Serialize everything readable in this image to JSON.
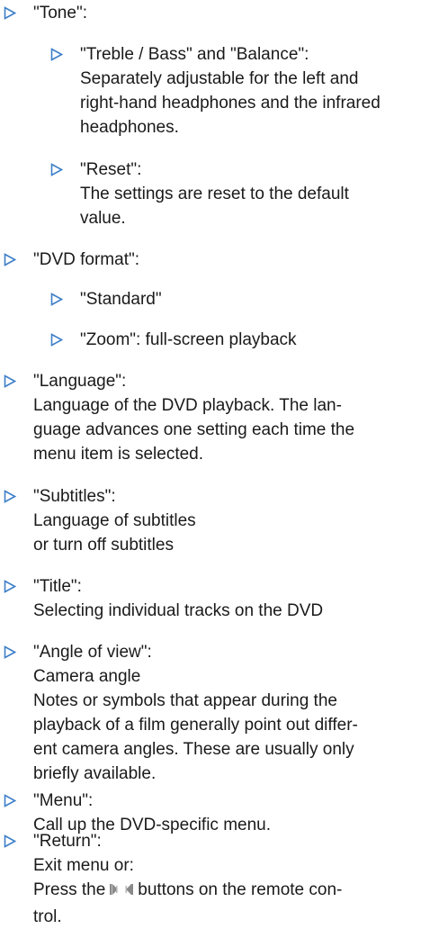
{
  "colors": {
    "arrow": "#3d7fc9",
    "text": "#1a1a1a"
  },
  "icons": {
    "bullet": "triangle-right-outline-icon",
    "buttons": "skip-buttons-icon"
  },
  "items": {
    "tone": {
      "title": "\"Tone\":"
    },
    "treble": {
      "title": "\"Treble / Bass\" and \"Balance\":",
      "desc": [
        "Separately adjustable for the left and",
        "right-hand headphones and the infrared",
        "headphones."
      ]
    },
    "reset": {
      "title": "\"Reset\":",
      "desc": [
        "The settings are reset to the default",
        "value."
      ]
    },
    "dvd_format": {
      "title": "\"DVD format\":"
    },
    "standard": {
      "title": "\"Standard\""
    },
    "zoom": {
      "title": "\"Zoom\": full-screen playback"
    },
    "language": {
      "title": "\"Language\":",
      "desc": [
        "Language of the DVD playback. The lan-",
        "guage advances one setting each time the",
        "menu item is selected."
      ]
    },
    "subtitles": {
      "title": "\"Subtitles\":",
      "desc": [
        "Language of subtitles",
        "or turn off subtitles"
      ]
    },
    "title_item": {
      "title": "\"Title\":",
      "desc": [
        "Selecting individual tracks on the DVD"
      ]
    },
    "angle": {
      "title": "\"Angle of view\":",
      "desc": [
        "Camera angle",
        "Notes or symbols that appear during the",
        "playback of a film generally point out differ-",
        "ent camera angles. These are usually only",
        "briefly available."
      ]
    },
    "menu": {
      "title": "\"Menu\":",
      "desc": [
        "Call up the DVD-specific menu."
      ]
    },
    "return": {
      "title": "\"Return\":",
      "desc_1": "Exit menu or:",
      "desc_2_before": "Press the",
      "desc_2_after": "buttons on the remote con-",
      "desc_3": "trol."
    }
  }
}
